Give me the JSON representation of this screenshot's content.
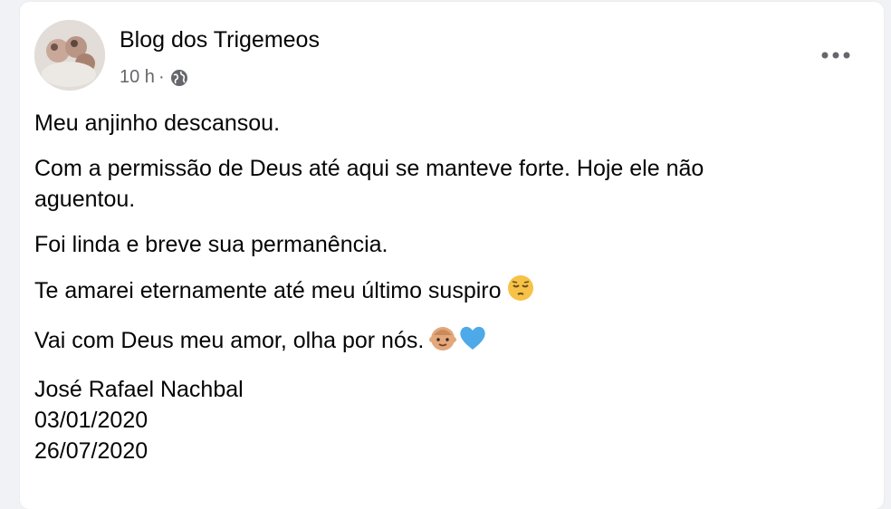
{
  "post": {
    "author": "Blog dos Trigemeos",
    "time": "10 h",
    "separator": "·",
    "privacy_icon": "globe-icon",
    "more_icon": "more-options-icon",
    "lines": {
      "l1": "Meu anjinho descansou.",
      "l2a": "Com a permissão de Deus até aqui se manteve forte. Hoje ele não",
      "l2b": "aguentou.",
      "l3": "Foi linda e breve sua permanência.",
      "l4": "Te amarei eternamente até meu último suspiro",
      "l5": "Vai com Deus meu amor, olha por nós.",
      "sig_name": "José Rafael Nachbal",
      "sig_date1": "03/01/2020",
      "sig_date2": "26/07/2020"
    },
    "emojis": {
      "e1": "pensive-face-icon",
      "e2": "baby-face-icon",
      "e3": "blue-heart-icon"
    }
  },
  "colors": {
    "text": "#050505",
    "meta": "#65676b",
    "background": "#f0f2f5",
    "card": "#ffffff",
    "heart": "#4ea9e8"
  }
}
